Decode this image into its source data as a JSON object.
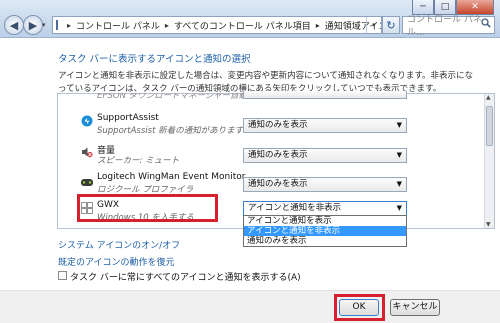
{
  "window": {
    "minimize_glyph": "─",
    "maximize_glyph": "□",
    "close_glyph": "✕"
  },
  "nav": {
    "back_glyph": "◀",
    "forward_glyph": "▶",
    "dropdown_glyph": "▾",
    "refresh_glyph": "↻"
  },
  "breadcrumb": {
    "separator": "▸",
    "items": [
      "コントロール パネル",
      "すべてのコントロール パネル項目",
      "通知領域アイコン"
    ]
  },
  "search": {
    "placeholder": "コントロール パネル...",
    "icon": "search-icon"
  },
  "content": {
    "heading": "タスク バーに表示するアイコンと通知の選択",
    "description": "アイコンと通知を非表示に設定した場合は、変更内容や更新内容について通知されなくなります。非表示になっているアイコンは、タスク バーの通知領域の横にある矢印をクリックしていつでも表示できます。"
  },
  "icons_list": {
    "partial_row": "EPSON ダウンロードマネージャー自動ダ...",
    "rows": [
      {
        "name": "SupportAssist",
        "sub": "SupportAssist 新着の通知があります",
        "behavior": "通知のみを表示",
        "icon": "supportassist-icon"
      },
      {
        "name": "音量",
        "sub": "スピーカー: ミュート",
        "behavior": "通知のみを表示",
        "icon": "volume-muted-icon"
      },
      {
        "name": "Logitech WingMan Event Monitor",
        "sub": "ロジクール プロファイラ",
        "behavior": "通知のみを表示",
        "icon": "logitech-icon"
      },
      {
        "name": "GWX",
        "sub": "Windows 10 を入手する",
        "behavior": "アイコンと通知を非表示",
        "icon": "windows-icon"
      }
    ],
    "dropdown_options": [
      "アイコンと通知を表示",
      "アイコンと通知を非表示",
      "通知のみを表示"
    ],
    "dropdown_selected_index": 1
  },
  "links": {
    "system_icons": "システム アイコンのオン/オフ",
    "restore_defaults": "既定のアイコンの動作を復元"
  },
  "always_show": {
    "label": "タスク バーに常にすべてのアイコンと通知を表示する(A)",
    "checked": false
  },
  "buttons": {
    "ok": "OK",
    "cancel": "キャンセル"
  },
  "colors": {
    "highlight": "#3399ff",
    "annotation_red": "#d7202f",
    "link": "#1e5fa8"
  }
}
